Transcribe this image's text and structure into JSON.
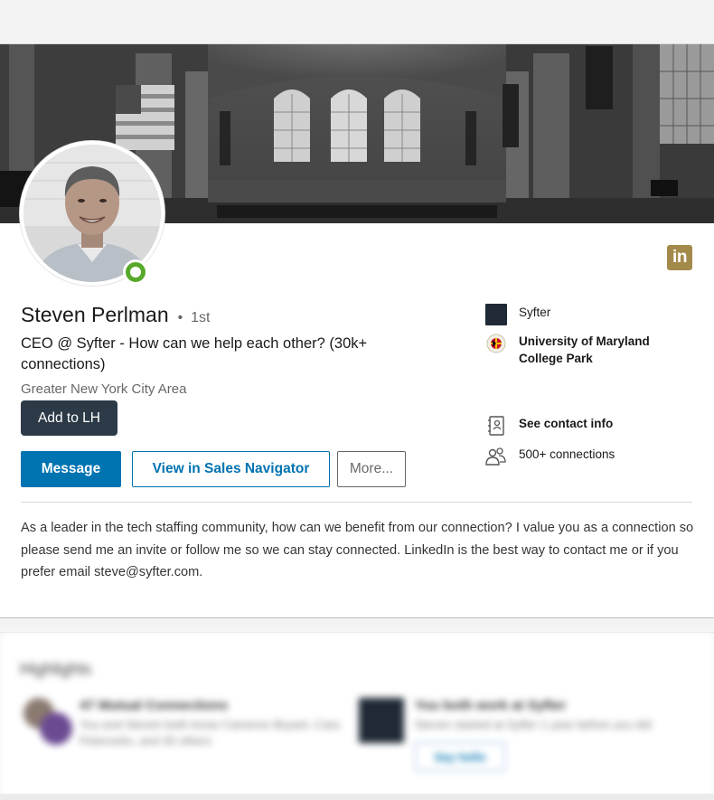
{
  "profile": {
    "name": "Steven Perlman",
    "degree_separator": "•",
    "degree": "1st",
    "headline": "CEO @ Syfter - How can we help each other? (30k+ connections)",
    "location": "Greater New York City Area",
    "online_status_color": "#57a82b"
  },
  "badges": {
    "linkedin_logo_text": "in",
    "linkedin_logo_color": "#a48a4a"
  },
  "actions": {
    "add_to_lh": "Add to LH",
    "message": "Message",
    "view_sales_navigator": "View in Sales Navigator",
    "more": "More..."
  },
  "right_column": {
    "company": {
      "label": "Syfter",
      "icon": "company-logo-icon"
    },
    "education": {
      "label": "University of Maryland College Park",
      "icon": "university-seal-icon"
    },
    "contact_info": {
      "label": "See contact info",
      "icon": "contact-card-icon"
    },
    "connections": {
      "label": "500+ connections",
      "icon": "people-icon"
    }
  },
  "summary": "As a leader in the tech staffing community, how can we benefit from our connection? I value you as a connection so please send me an invite or follow me so we can stay connected. LinkedIn is the best way to contact me or if you prefer email steve@syfter.com.",
  "highlights": {
    "title": "Highlights",
    "items": [
      {
        "heading": "47 Mutual Connections",
        "text": "You and Steven both know Cameron Bryant, Cara Petersohn, and 45 others"
      },
      {
        "heading": "You both work at Syfter",
        "text": "Steven started at Syfter 1 year before you did",
        "button": "Say hello"
      }
    ]
  },
  "colors": {
    "primary_blue": "#0073b1",
    "lh_button": "#2c3a47",
    "syfter_brand": "#1f2a36"
  }
}
